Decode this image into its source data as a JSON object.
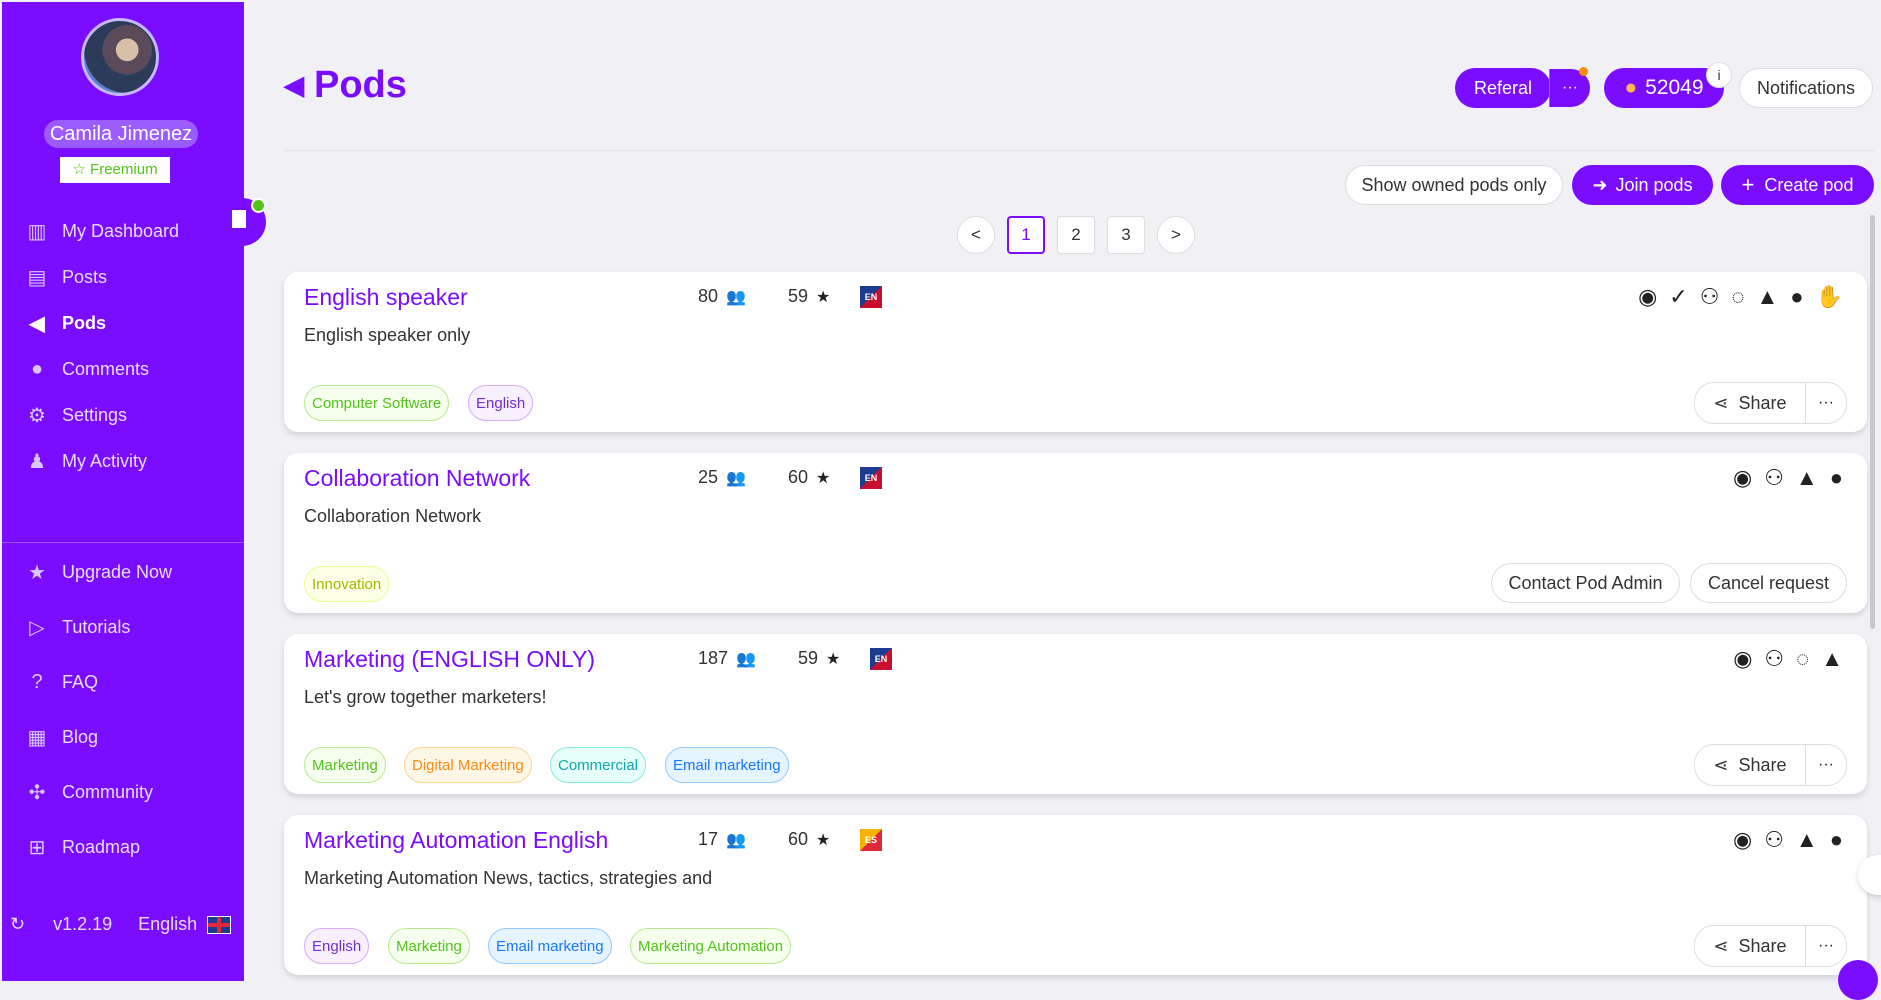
{
  "sidebar": {
    "user_name": "Camila Jimenez",
    "plan": "☆ Freemium",
    "items": [
      {
        "label": "My Dashboard",
        "icon": "bar-chart-icon",
        "glyph": "📊"
      },
      {
        "label": "Posts",
        "icon": "document-icon",
        "glyph": "▤"
      },
      {
        "label": "Pods",
        "icon": "megaphone-icon",
        "glyph": "📢"
      },
      {
        "label": "Comments",
        "icon": "comment-icon",
        "glyph": "💬"
      },
      {
        "label": "Settings",
        "icon": "gear-icon",
        "glyph": "⚙"
      },
      {
        "label": "My Activity",
        "icon": "user-icon",
        "glyph": "👤"
      },
      {
        "label": "Upgrade Now",
        "icon": "star-icon",
        "glyph": "★"
      },
      {
        "label": "Tutorials",
        "icon": "play-icon",
        "glyph": "▶"
      },
      {
        "label": "FAQ",
        "icon": "question-icon",
        "glyph": "?"
      },
      {
        "label": "Blog",
        "icon": "blog-icon",
        "glyph": "▦"
      },
      {
        "label": "Community",
        "icon": "slack-icon",
        "glyph": "✣"
      },
      {
        "label": "Roadmap",
        "icon": "sitemap-icon",
        "glyph": "⊞"
      }
    ],
    "version": "v1.2.19",
    "language": "English"
  },
  "header": {
    "title": "Pods",
    "referal_label": "Referal",
    "more": "···",
    "credits": "52049",
    "credits_info": "i",
    "notifications_label": "Notifications"
  },
  "toolbar": {
    "show_owned_label": "Show owned pods only",
    "join_label": "Join pods",
    "create_label": "Create pod"
  },
  "pagination": {
    "prev": "<",
    "pages": [
      "1",
      "2",
      "3"
    ],
    "current": "1",
    "next": ">"
  },
  "pods": [
    {
      "title": "English speaker",
      "description": "English speaker only",
      "members": "80",
      "rating": "59",
      "lang": "EN",
      "tags": [
        "Computer Software",
        "English"
      ],
      "actions": [
        "eye-icon",
        "check-icon",
        "user-check-icon",
        "comment-dots-icon",
        "thumbs-up-icon",
        "comment-icon",
        "clap-icon"
      ],
      "share_label": "Share",
      "more": "···"
    },
    {
      "title": "Collaboration Network",
      "description": "Collaboration Network",
      "members": "25",
      "rating": "60",
      "lang": "EN",
      "tags": [
        "Innovation"
      ],
      "actions": [
        "eye-icon",
        "user-check-icon",
        "thumbs-up-icon",
        "comment-icon"
      ],
      "contact_label": "Contact Pod Admin",
      "cancel_label": "Cancel request"
    },
    {
      "title": "Marketing (ENGLISH ONLY)",
      "description": "Let's grow together marketers!",
      "members": "187",
      "rating": "59",
      "lang": "EN",
      "tags": [
        "Marketing",
        "Digital Marketing",
        "Commercial",
        "Email marketing"
      ],
      "actions": [
        "eye-icon",
        "user-lock-icon",
        "comment-dots-icon",
        "thumbs-up-icon"
      ],
      "share_label": "Share",
      "more": "···"
    },
    {
      "title": "Marketing Automation English",
      "description": "Marketing Automation News, tactics, strategies and",
      "members": "17",
      "rating": "60",
      "lang": "ES",
      "tags": [
        "English",
        "Marketing",
        "Email marketing",
        "Marketing Automation"
      ],
      "actions": [
        "eye-icon",
        "user-check-icon",
        "thumbs-up-icon",
        "comment-icon"
      ],
      "share_label": "Share",
      "more": "···"
    }
  ],
  "colors": {
    "brand": "#7a0cff",
    "background": "#f0f0f5"
  }
}
